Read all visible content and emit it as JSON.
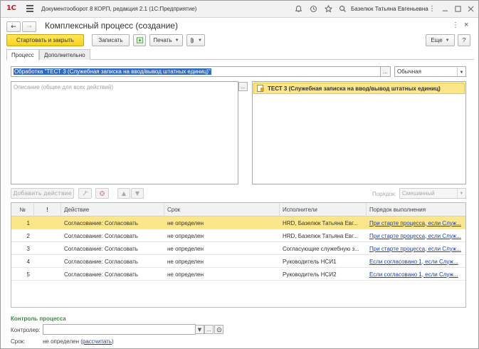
{
  "app": {
    "logo_text": "1С",
    "title": "Документооборот 8 КОРП, редакция 2.1  (1С:Предприятие)",
    "user": "Базелюк Татьяна Евгеньевна"
  },
  "icons": {
    "menu": "hamburger-icon",
    "bell": "bell-icon",
    "history": "history-icon",
    "star": "star-icon",
    "search": "search-icon",
    "more": "more-icon",
    "minimize": "minimize-icon",
    "maximize": "maximize-icon",
    "close": "close-icon"
  },
  "form": {
    "title": "Комплексный процесс (создание)",
    "nav_back": "←",
    "nav_forward": "→",
    "more_dots": "⋮",
    "close": "×"
  },
  "toolbar": {
    "start_close": "Стартовать и закрыть",
    "save": "Записать",
    "print": "Печать",
    "more": "Еще",
    "help": "?"
  },
  "tabs": [
    {
      "label": "Процесс"
    },
    {
      "label": "Дополнительно"
    }
  ],
  "process": {
    "name_value": "Обработка \"ТЕСТ 3 (Служебная записка на ввод/вывод штатных единиц)\"",
    "priority": "Обычная",
    "description_placeholder": "Описание (общее для всех действий)",
    "subject": "ТЕСТ 3 (Служебная записка на ввод/вывод штатных единиц)"
  },
  "table_toolbar": {
    "add_action": "Добавить действие",
    "order_label": "Порядок:",
    "order_value": "Смешанный"
  },
  "table": {
    "columns": [
      "№",
      "!",
      "Действие",
      "Срок",
      "Исполнители",
      "Порядок выполнения"
    ],
    "rows": [
      {
        "n": "1",
        "action": "Согласование: Согласовать",
        "due": "не определен",
        "performers": "HRD, Базелюк Татьяна Евг...",
        "order": "При старте процесса, если Служ..."
      },
      {
        "n": "2",
        "action": "Согласование: Согласовать",
        "due": "не определен",
        "performers": "HRD, Базелюк Татьяна Евг...",
        "order": "При старте процесса, если Служ..."
      },
      {
        "n": "3",
        "action": "Согласование: Согласовать",
        "due": "не определен",
        "performers": "Согласующие служебную з...",
        "order": "При старте процесса, если Служ..."
      },
      {
        "n": "4",
        "action": "Согласование: Согласовать",
        "due": "не определен",
        "performers": "Руководитель НСИ1",
        "order": "Если согласовано 1, если Служ..."
      },
      {
        "n": "5",
        "action": "Согласование: Согласовать",
        "due": "не определен",
        "performers": "Руководитель НСИ2",
        "order": "Если согласовано 1, если Служ..."
      }
    ]
  },
  "control": {
    "title": "Контроль процесса",
    "controller_label": "Контролер:",
    "controller_value": "",
    "due_label": "Срок:",
    "due_value": "не определен",
    "calc_link": "рассчитать"
  },
  "colors": {
    "accent": "#f8d11a",
    "selected_row": "#fbe68b",
    "link": "#1a3fb1",
    "section_title": "#3d8b3d"
  }
}
